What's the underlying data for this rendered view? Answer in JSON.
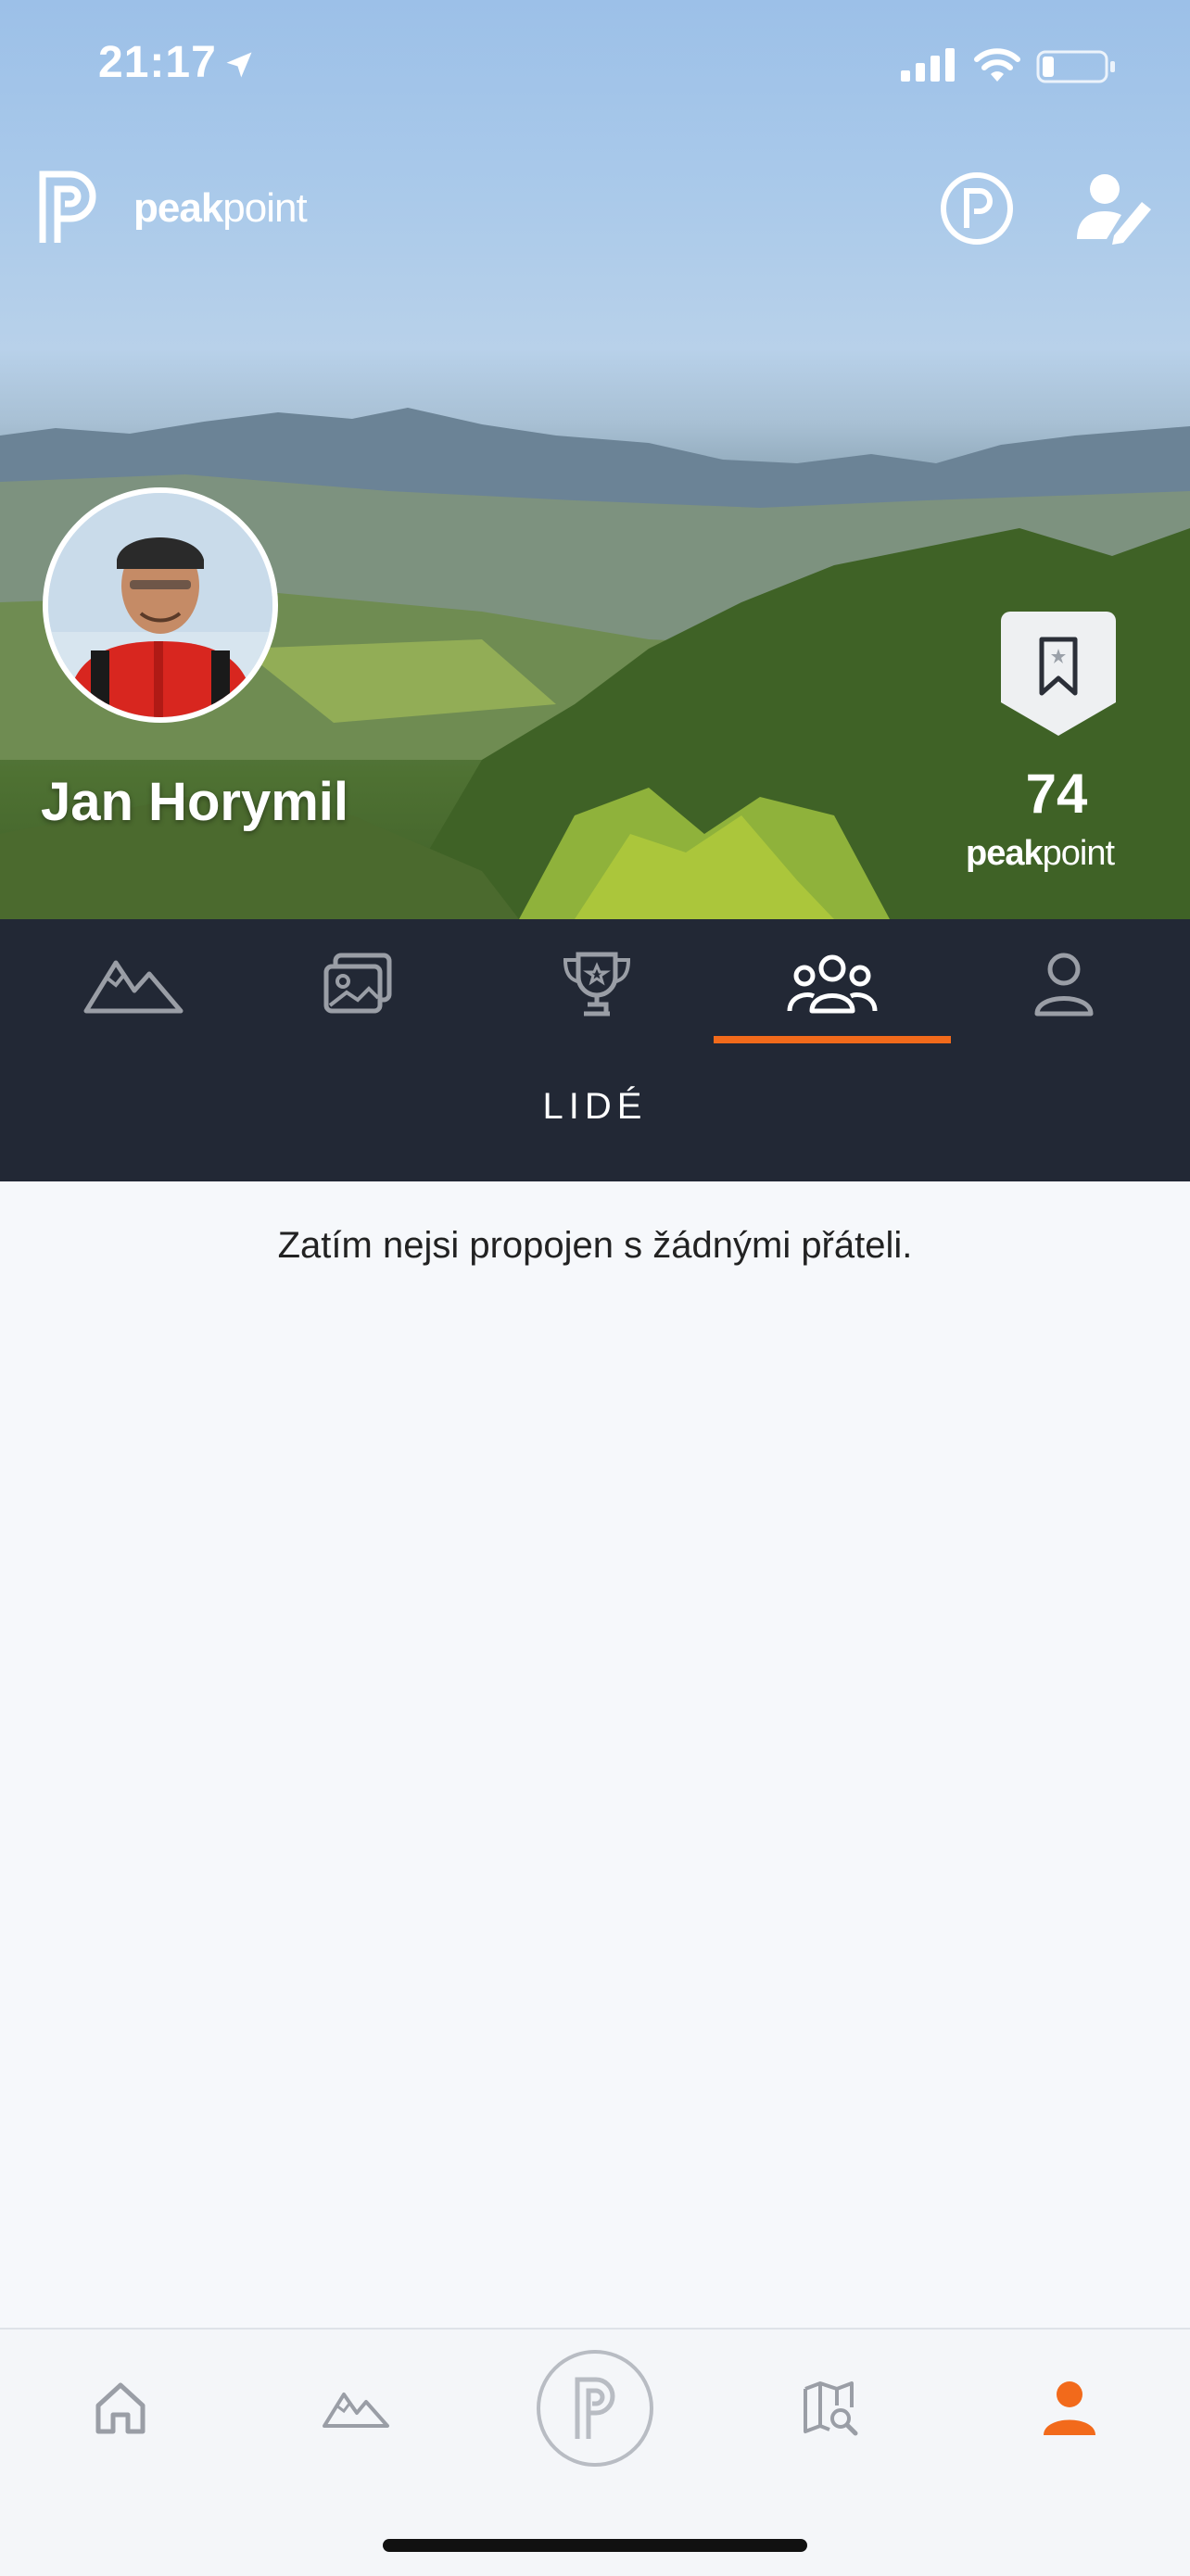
{
  "status_bar": {
    "time": "21:17",
    "icons": [
      "location-arrow-icon",
      "cellular-signal-icon",
      "wifi-icon",
      "battery-icon"
    ]
  },
  "header": {
    "logo_text_bold": "peak",
    "logo_text_light": "point",
    "buttons": [
      "peakpoint-icon",
      "edit-profile-icon"
    ]
  },
  "profile": {
    "name": "Jan Horymil",
    "points": "74",
    "points_label_bold": "peak",
    "points_label_light": "point"
  },
  "tabs": [
    {
      "icon": "mountains-icon",
      "active": false
    },
    {
      "icon": "photos-icon",
      "active": false
    },
    {
      "icon": "trophy-icon",
      "active": false
    },
    {
      "icon": "people-icon",
      "active": true
    },
    {
      "icon": "person-icon",
      "active": false
    }
  ],
  "section": {
    "title": "LIDÉ",
    "empty_message": "Zatím nejsi propojen s žádnými přáteli."
  },
  "bottom_nav": [
    {
      "icon": "home-icon",
      "active": false
    },
    {
      "icon": "mountains-icon",
      "active": false
    },
    {
      "icon": "peakpoint-center-icon",
      "active": false
    },
    {
      "icon": "map-search-icon",
      "active": false
    },
    {
      "icon": "profile-icon",
      "active": true
    }
  ],
  "colors": {
    "accent": "#f26a1b",
    "tab_bar_bg": "#222835",
    "inactive_icon": "#9a9ea6",
    "page_bg": "#f6f8fb"
  }
}
